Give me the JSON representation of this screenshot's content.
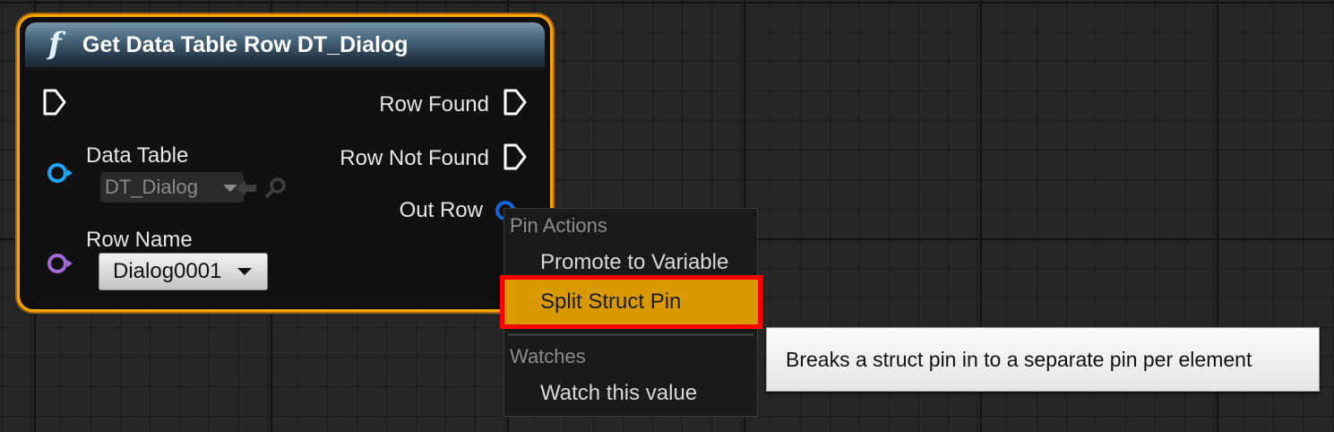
{
  "node": {
    "title": "Get Data Table Row DT_Dialog",
    "icon": "function-icon",
    "icon_glyph": "f",
    "border_color": "#f5a400",
    "inputs": {
      "data_table_label": "Data Table",
      "data_table_value": "DT_Dialog",
      "row_name_label": "Row Name",
      "row_name_value": "Dialog0001"
    },
    "outputs": {
      "row_found": "Row Found",
      "row_not_found": "Row Not Found",
      "out_row": "Out Row"
    }
  },
  "context_menu": {
    "sections": [
      {
        "header": "Pin Actions",
        "items": [
          {
            "label": "Promote to Variable"
          },
          {
            "label": "Split Struct Pin",
            "highlighted": true
          }
        ]
      },
      {
        "header": "Watches",
        "items": [
          {
            "label": "Watch this value"
          }
        ]
      }
    ],
    "highlight_color": "#d99a00",
    "annotation_border_color": "#ff0000"
  },
  "tooltip": {
    "text": "Breaks a struct pin in to a separate pin per element"
  },
  "colors": {
    "pin_data_table": "#1aa6ff",
    "pin_row_name": "#a36bd6",
    "pin_out_row": "#1565e0"
  }
}
